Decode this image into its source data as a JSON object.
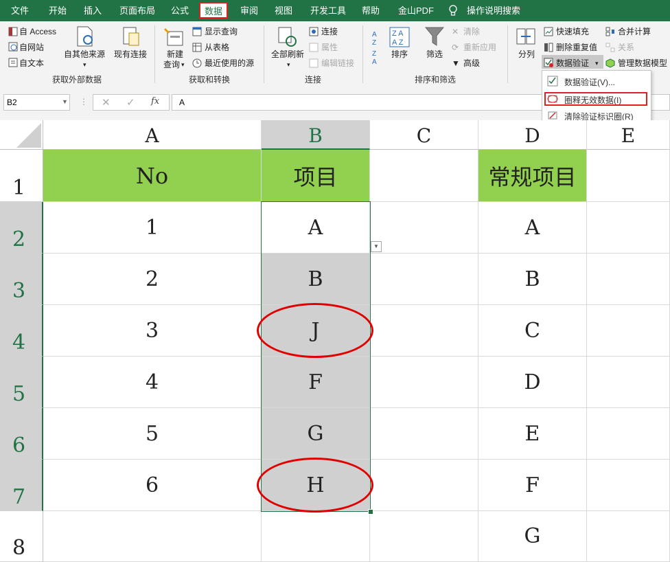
{
  "menu": {
    "tabs": [
      {
        "label": "文件"
      },
      {
        "label": "开始"
      },
      {
        "label": "插入"
      },
      {
        "label": "页面布局"
      },
      {
        "label": "公式"
      },
      {
        "label": "数据"
      },
      {
        "label": "审阅"
      },
      {
        "label": "视图"
      },
      {
        "label": "开发工具"
      },
      {
        "label": "帮助"
      },
      {
        "label": "金山PDF"
      }
    ],
    "search_label": "操作说明搜索",
    "active_tab": "数据"
  },
  "ribbon": {
    "get_external": {
      "access": "自 Access",
      "web": "自网站",
      "text": "自文本",
      "other": "自其他来源",
      "existing": "现有连接",
      "group": "获取外部数据"
    },
    "get_transform": {
      "new_query": "新建",
      "new_query2": "查询",
      "show_queries": "显示查询",
      "from_table": "从表格",
      "recent": "最近使用的源",
      "group": "获取和转换"
    },
    "connections": {
      "refresh_all": "全部刷新",
      "connections": "连接",
      "properties": "属性",
      "edit_links": "编辑链接",
      "group": "连接"
    },
    "sort_filter": {
      "sort": "排序",
      "filter": "筛选",
      "clear": "清除",
      "reapply": "重新应用",
      "advanced": "高级",
      "group": "排序和筛选"
    },
    "data_tools": {
      "text_to_cols": "分列",
      "flash_fill": "快速填充",
      "remove_dup": "删除重复值",
      "data_validation": "数据验证",
      "consolidate": "合并计算",
      "relationships": "关系",
      "manage_model": "管理数据模型"
    }
  },
  "validation_menu": {
    "items": [
      {
        "label": "数据验证(V)..."
      },
      {
        "label": "圈释无效数据(I)"
      },
      {
        "label": "清除验证标识圈(R)"
      }
    ]
  },
  "formula_bar": {
    "name_box": "B2",
    "fx": "fx",
    "value": "A"
  },
  "grid": {
    "columns": [
      "A",
      "B",
      "C",
      "D",
      "E"
    ],
    "rows": [
      "1",
      "2",
      "3",
      "4",
      "5",
      "6",
      "7",
      "8"
    ],
    "header_row": {
      "a": "No",
      "b": "项目",
      "d": "常规项目"
    },
    "col_a": [
      "1",
      "2",
      "3",
      "4",
      "5",
      "6"
    ],
    "col_b": [
      "A",
      "B",
      "J",
      "F",
      "G",
      "H"
    ],
    "col_d": [
      "A",
      "B",
      "C",
      "D",
      "E",
      "F",
      "G"
    ],
    "selected_cell": "B2",
    "invalid_circled": [
      "J",
      "H"
    ]
  },
  "colors": {
    "excel_green": "#217346",
    "header_fill": "#92d050",
    "highlight_red": "#e02020",
    "selection_gray": "#d0d0d0"
  }
}
